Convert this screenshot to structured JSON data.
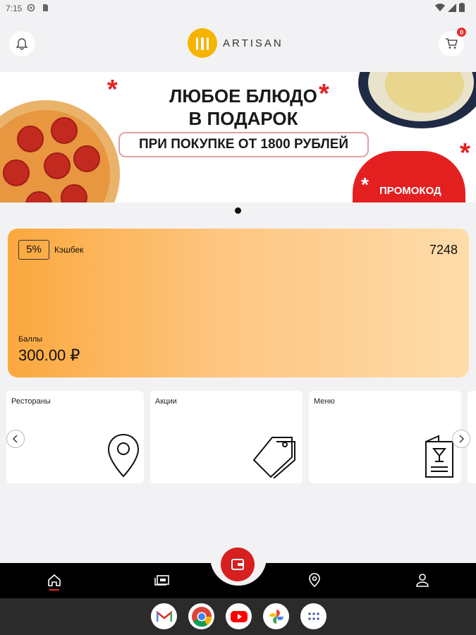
{
  "status_bar": {
    "time": "7:15"
  },
  "header": {
    "logo_text": "ARTISAN",
    "cart_count": "0"
  },
  "banner": {
    "line1": "ЛЮБОЕ БЛЮДО",
    "line2": "В ПОДАРОК",
    "condition": "ПРИ ПОКУПКЕ ОТ 1800 РУБЛЕЙ",
    "promo_label": "ПРОМОКОД"
  },
  "cashback": {
    "percent": "5%",
    "label": "Кэшбек",
    "card_number": "7248",
    "balance_label": "Баллы",
    "balance_value": "300.00 ₽"
  },
  "tiles": [
    {
      "title": "Рестораны",
      "icon": "location-pin-icon"
    },
    {
      "title": "Акции",
      "icon": "tags-icon"
    },
    {
      "title": "Меню",
      "icon": "menu-card-icon"
    }
  ],
  "bottom_nav": [
    "home-icon",
    "news-icon",
    "location-icon",
    "profile-icon"
  ],
  "dock_apps": [
    "gmail-icon",
    "chrome-icon",
    "youtube-icon",
    "photos-icon",
    "apps-icon"
  ],
  "colors": {
    "accent": "#d81f1f",
    "card_start": "#fba83d",
    "card_end": "#fedcaa",
    "logo": "#f6b400"
  }
}
